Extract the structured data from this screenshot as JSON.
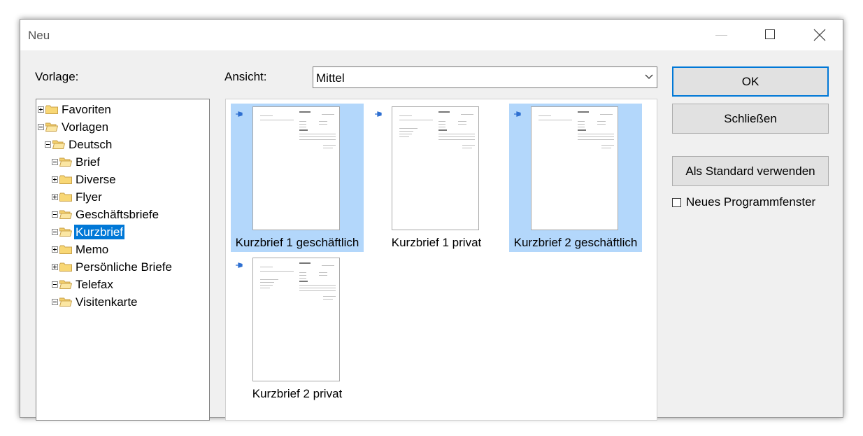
{
  "window": {
    "title": "Neu"
  },
  "labels": {
    "template": "Vorlage:",
    "view": "Ansicht:"
  },
  "view_select": {
    "value": "Mittel"
  },
  "tree": [
    {
      "label": "Favoriten",
      "level": 0,
      "expander": "plus",
      "folder": "closed"
    },
    {
      "label": "Vorlagen",
      "level": 0,
      "expander": "minus",
      "folder": "open"
    },
    {
      "label": "Deutsch",
      "level": 1,
      "expander": "minus",
      "folder": "open"
    },
    {
      "label": "Brief",
      "level": 2,
      "expander": "minus",
      "folder": "open"
    },
    {
      "label": "Diverse",
      "level": 2,
      "expander": "plus",
      "folder": "closed"
    },
    {
      "label": "Flyer",
      "level": 2,
      "expander": "plus",
      "folder": "closed"
    },
    {
      "label": "Geschäftsbriefe",
      "level": 2,
      "expander": "minus",
      "folder": "open"
    },
    {
      "label": "Kurzbrief",
      "level": 2,
      "expander": "minus",
      "folder": "open",
      "selected": true
    },
    {
      "label": "Memo",
      "level": 2,
      "expander": "plus",
      "folder": "closed"
    },
    {
      "label": "Persönliche Briefe",
      "level": 2,
      "expander": "plus",
      "folder": "closed"
    },
    {
      "label": "Telefax",
      "level": 2,
      "expander": "minus",
      "folder": "open"
    },
    {
      "label": "Visitenkarte",
      "level": 2,
      "expander": "minus",
      "folder": "open"
    }
  ],
  "templates": [
    {
      "label": "Kurzbrief 1 geschäftlich",
      "selected": true
    },
    {
      "label": "Kurzbrief 1 privat",
      "selected": false
    },
    {
      "label": "Kurzbrief 2 geschäftlich",
      "selected": true
    },
    {
      "label": "Kurzbrief 2 privat",
      "selected": false
    }
  ],
  "buttons": {
    "ok": "OK",
    "close": "Schließen",
    "set_default": "Als Standard verwenden"
  },
  "options": {
    "new_window_label": "Neues Programmfenster",
    "new_window_checked": false
  },
  "colors": {
    "selection": "#0078d7",
    "tile_selected": "#b3d7fb",
    "pin": "#2e6fd1"
  }
}
